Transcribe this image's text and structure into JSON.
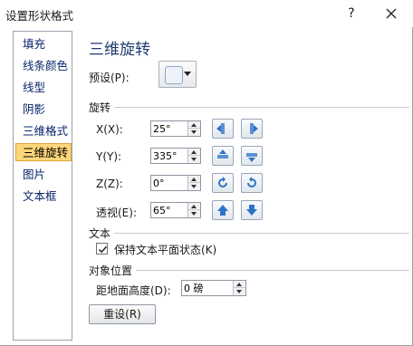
{
  "window": {
    "title": "设置形状格式",
    "help_label": "?",
    "close_label": "✕"
  },
  "nav": {
    "items": [
      {
        "label": "填充"
      },
      {
        "label": "线条颜色"
      },
      {
        "label": "线型"
      },
      {
        "label": "阴影"
      },
      {
        "label": "三维格式"
      },
      {
        "label": "三维旋转",
        "selected": true
      },
      {
        "label": "图片"
      },
      {
        "label": "文本框"
      }
    ]
  },
  "page": {
    "title": "三维旋转",
    "preset_label": "预设(P):",
    "rotation_section": "旋转",
    "x_label": "X(X):",
    "x_value": "25°",
    "y_label": "Y(Y):",
    "y_value": "335°",
    "z_label": "Z(Z):",
    "z_value": "0°",
    "perspective_label": "透视(E):",
    "perspective_value": "65°",
    "text_section": "文本",
    "keep_text_flat_label": "保持文本平面状态(K)",
    "keep_text_flat_checked": true,
    "object_position_section": "对象位置",
    "distance_label": "距地面高度(D):",
    "distance_value": "0 磅",
    "reset_label": "重设(R)"
  },
  "icons": {
    "x_left": "rotate-left-icon",
    "x_right": "rotate-right-icon",
    "y_up": "rotate-up-icon",
    "y_down": "rotate-down-icon",
    "z_ccw": "rotate-counterclockwise-icon",
    "z_cw": "rotate-clockwise-icon",
    "perspective_increase": "perspective-increase-icon",
    "perspective_decrease": "perspective-decrease-icon"
  },
  "colors": {
    "accent_blue": "#2f73c8",
    "selected_nav_bg": "#fdd67a",
    "selected_nav_border": "#e0a23c"
  }
}
